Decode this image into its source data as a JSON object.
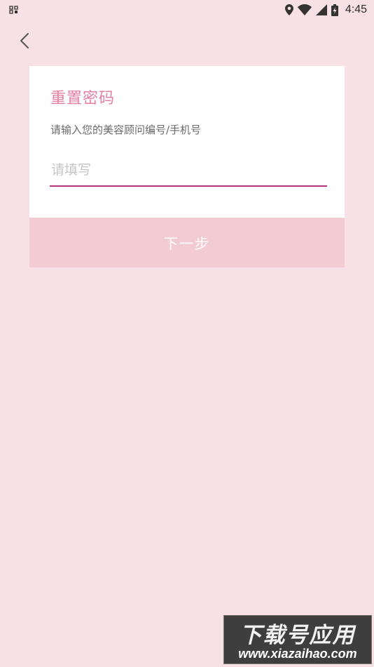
{
  "status_bar": {
    "time": "4:45",
    "icons": [
      "sim-card-icon",
      "location-icon",
      "wifi-icon",
      "signal-icon",
      "battery-charging-icon"
    ]
  },
  "nav": {
    "back_icon": "chevron-left-icon"
  },
  "card": {
    "title": "重置密码",
    "subtitle": "请输入您的美容顾问编号/手机号",
    "input_placeholder": "请填写",
    "input_value": ""
  },
  "next_button": {
    "label": "下一步"
  },
  "watermark": {
    "title": "下载号应用",
    "url": "www.xiazaihao.com"
  },
  "colors": {
    "background": "#f7e1e6",
    "accent": "#e57ea3",
    "underline": "#b8327a",
    "button_bg": "#f3cbd3"
  }
}
